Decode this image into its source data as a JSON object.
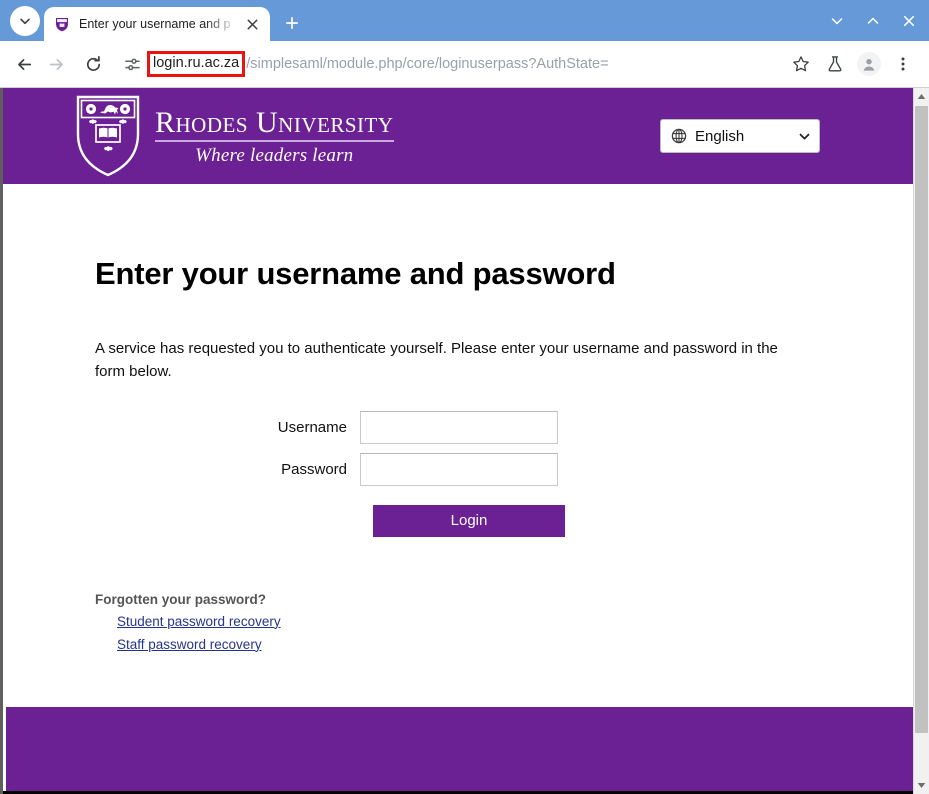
{
  "browser": {
    "tab": {
      "title": "Enter your username and p",
      "favicon_icon": "rhodes-crest-favicon",
      "close_icon": "close-icon",
      "search_tabs_icon": "chevron-down-icon",
      "new_tab_icon": "plus-icon"
    },
    "window_controls": {
      "minimize_icon": "chevron-down-icon",
      "maximize_icon": "chevron-up-icon",
      "close_icon": "x-icon"
    },
    "toolbar": {
      "back_icon": "arrow-left-icon",
      "forward_icon": "arrow-right-icon",
      "reload_icon": "reload-icon",
      "site_info_icon": "tune-sliders-icon",
      "bookmark_icon": "star-icon",
      "labs_icon": "flask-icon",
      "profile_icon": "avatar-icon",
      "menu_icon": "three-dots-icon"
    },
    "address_bar": {
      "domain": "login.ru.ac.za",
      "path": "/simplesaml/module.php/core/loginuserpass?AuthState=",
      "highlight_color": "#ee1111"
    }
  },
  "site": {
    "header": {
      "brand_name": "Rhodes University",
      "brand_tagline": "Where leaders learn",
      "crest_icon": "rhodes-crest-icon",
      "background_color": "#6b2194"
    },
    "language": {
      "globe_icon": "globe-icon",
      "selected": "English",
      "caret_icon": "chevron-down-icon",
      "options": [
        "English"
      ]
    },
    "main": {
      "title": "Enter your username and password",
      "intro": "A service has requested you to authenticate yourself. Please enter your username and password in the form below."
    },
    "form": {
      "username_label": "Username",
      "username_value": "",
      "username_placeholder": "",
      "password_label": "Password",
      "password_value": "",
      "password_placeholder": "",
      "login_button": "Login",
      "button_color": "#6b2194"
    },
    "recovery": {
      "heading": "Forgotten your password?",
      "links": [
        "Student password recovery",
        "Staff password recovery"
      ],
      "link_color": "#25348b"
    },
    "footer": {
      "background_color": "#6b2194"
    }
  },
  "scrollbar": {
    "up_arrow_icon": "triangle-up-icon",
    "down_arrow_icon": "triangle-down-icon"
  }
}
